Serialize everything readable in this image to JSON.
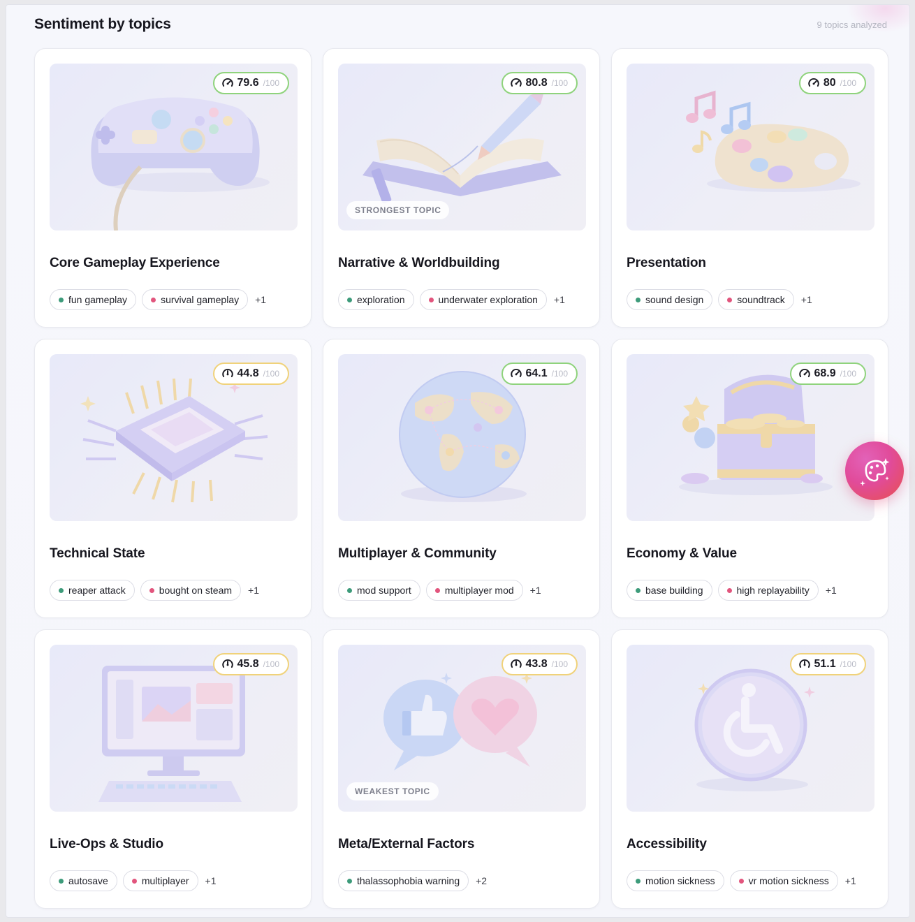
{
  "header": {
    "title": "Sentiment by topics",
    "count_label": "9 topics analyzed"
  },
  "colors": {
    "score_high_border": "#8fd37c",
    "score_mid_border": "#f0d27a",
    "positive_dot": "#3d9b7a",
    "negative_dot": "#e2557d",
    "fab_gradient": [
      "#e262b8",
      "#e8514c"
    ]
  },
  "score_max_label": "/100",
  "cards": [
    {
      "title": "Core Gameplay Experience",
      "score": "79.6",
      "score_level": "high",
      "icon": "game-controller",
      "tags": [
        {
          "label": "fun gameplay",
          "sentiment": "positive"
        },
        {
          "label": "survival gameplay",
          "sentiment": "negative"
        }
      ],
      "more": "+1",
      "badge": ""
    },
    {
      "title": "Narrative & Worldbuilding",
      "score": "80.8",
      "score_level": "high",
      "icon": "open-book-pen",
      "tags": [
        {
          "label": "exploration",
          "sentiment": "positive"
        },
        {
          "label": "underwater exploration",
          "sentiment": "negative"
        }
      ],
      "more": "+1",
      "badge": "STRONGEST TOPIC"
    },
    {
      "title": "Presentation",
      "score": "80",
      "score_level": "high",
      "icon": "paint-palette-music",
      "tags": [
        {
          "label": "sound design",
          "sentiment": "positive"
        },
        {
          "label": "soundtrack",
          "sentiment": "negative"
        }
      ],
      "more": "+1",
      "badge": ""
    },
    {
      "title": "Technical State",
      "score": "44.8",
      "score_level": "mid",
      "icon": "cpu-chip",
      "tags": [
        {
          "label": "reaper attack",
          "sentiment": "positive"
        },
        {
          "label": "bought on steam",
          "sentiment": "negative"
        }
      ],
      "more": "+1",
      "badge": ""
    },
    {
      "title": "Multiplayer & Community",
      "score": "64.1",
      "score_level": "high",
      "icon": "globe-network",
      "tags": [
        {
          "label": "mod support",
          "sentiment": "positive"
        },
        {
          "label": "multiplayer mod",
          "sentiment": "negative"
        }
      ],
      "more": "+1",
      "badge": ""
    },
    {
      "title": "Economy & Value",
      "score": "68.9",
      "score_level": "high",
      "icon": "treasure-chest",
      "tags": [
        {
          "label": "base building",
          "sentiment": "positive"
        },
        {
          "label": "high replayability",
          "sentiment": "negative"
        }
      ],
      "more": "+1",
      "badge": ""
    },
    {
      "title": "Live-Ops & Studio",
      "score": "45.8",
      "score_level": "mid",
      "icon": "desktop-computer",
      "tags": [
        {
          "label": "autosave",
          "sentiment": "positive"
        },
        {
          "label": "multiplayer",
          "sentiment": "negative"
        }
      ],
      "more": "+1",
      "badge": ""
    },
    {
      "title": "Meta/External Factors",
      "score": "43.8",
      "score_level": "mid",
      "icon": "speech-bubbles",
      "tags": [
        {
          "label": "thalassophobia warning",
          "sentiment": "positive"
        }
      ],
      "more": "+2",
      "badge": "WEAKEST TOPIC"
    },
    {
      "title": "Accessibility",
      "score": "51.1",
      "score_level": "mid",
      "icon": "wheelchair-accessibility",
      "tags": [
        {
          "label": "motion sickness",
          "sentiment": "positive"
        },
        {
          "label": "vr motion sickness",
          "sentiment": "negative"
        }
      ],
      "more": "+1",
      "badge": ""
    }
  ],
  "assistant_button": {
    "icon": "sparkle-palette"
  }
}
